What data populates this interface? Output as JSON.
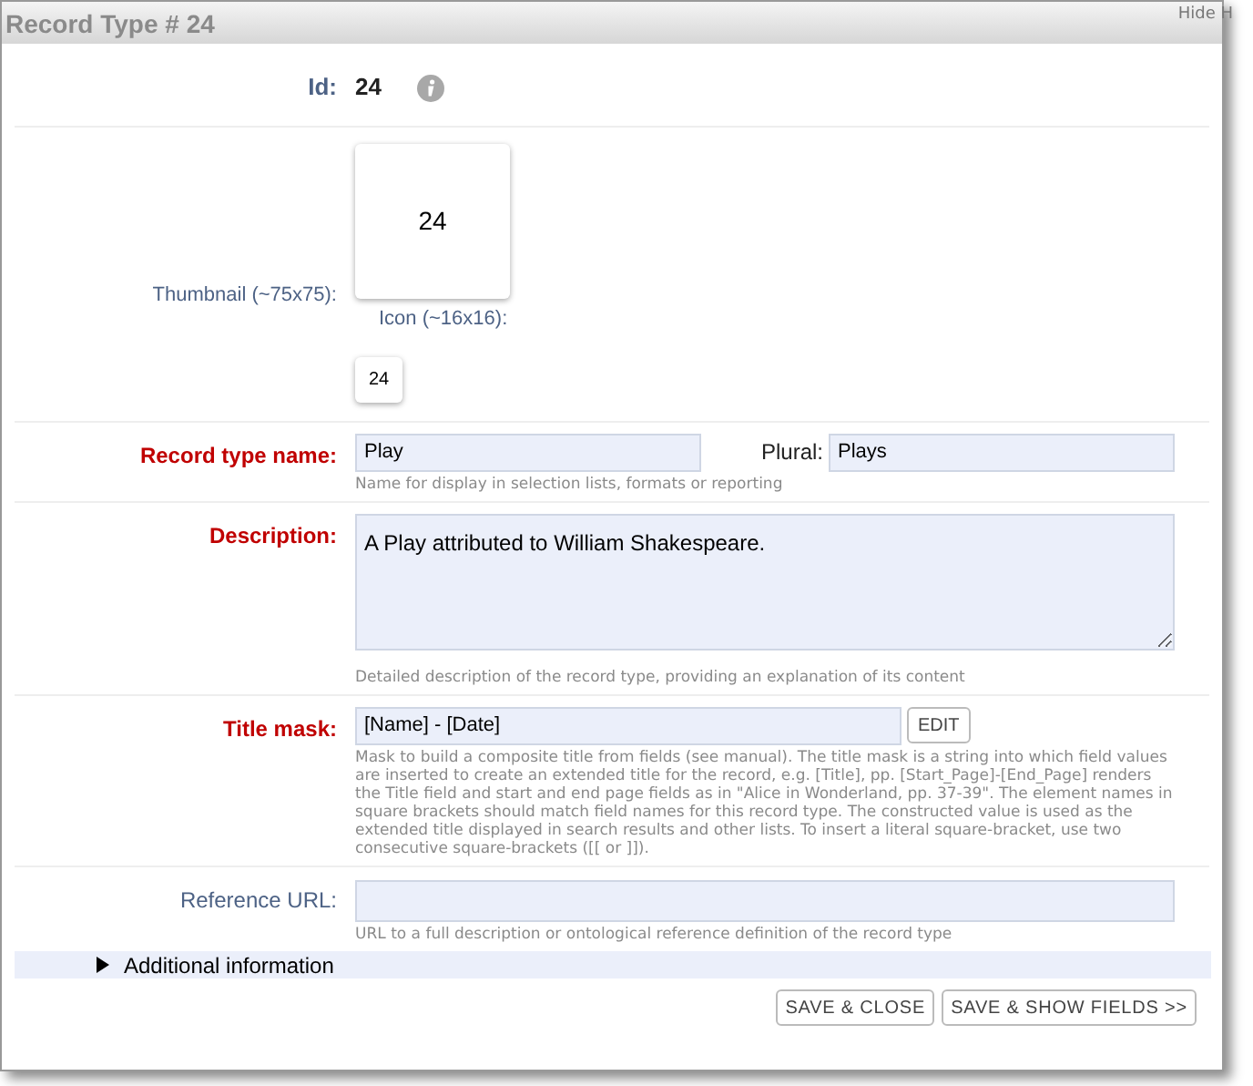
{
  "window": {
    "title": "Record Type # 24",
    "hide_link": "Hide H"
  },
  "id": {
    "label": "Id:",
    "value": "24"
  },
  "thumbnail": {
    "label": "Thumbnail (~75x75):",
    "text": "24",
    "icon_label": "Icon (~16x16):",
    "icon_text": "24"
  },
  "fields": [
    {
      "kind": "pair",
      "label": "Record type name:",
      "required": true,
      "value": "Play",
      "second_label": "Plural:",
      "second_value": "Plays",
      "help": "Name for display in selection lists, formats or reporting"
    },
    {
      "kind": "textarea",
      "label": "Description:",
      "required": true,
      "value": "A Play attributed to William Shakespeare.",
      "help": "Detailed description of the record type, providing an explanation of its content"
    },
    {
      "kind": "mask",
      "label": "Title mask:",
      "required": true,
      "value": "[Name] - [Date]",
      "button": "EDIT",
      "help": "Mask to build a composite title from fields (see manual). The title mask is a string into which field values are inserted to create an extended title for the record, e.g. [Title], pp. [Start_Page]-[End_Page] renders the Title field and start and end page fields as in \"Alice in Wonderland, pp. 37-39\". The element names in square brackets should match field names for this record type. The constructed value is used as the extended title displayed in search results and other lists. To insert a literal square-bracket, use two consecutive square-brackets ([[ or ]])."
    },
    {
      "kind": "text",
      "label": "Reference URL:",
      "required": false,
      "help": "URL to a full description or ontological reference definition of the record type"
    }
  ],
  "additional": {
    "label": "Additional information",
    "expanded": false
  },
  "buttons": [
    "SAVE & CLOSE",
    "SAVE & SHOW FIELDS >>"
  ]
}
